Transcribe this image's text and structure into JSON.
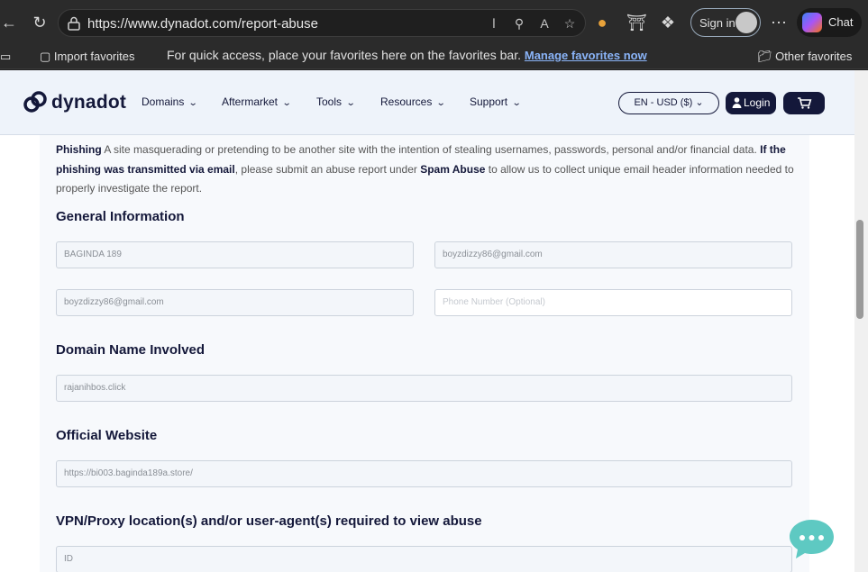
{
  "browser": {
    "url": "https://www.dynadot.com/report-abuse",
    "sign_in_label": "Sign in",
    "chat_label": "Chat"
  },
  "favorites_bar": {
    "import_label": "Import favorites",
    "message": "For quick access, place your favorites here on the favorites bar.",
    "manage_link": "Manage favorites now",
    "other_label": "Other favorites"
  },
  "site": {
    "brand": "dynadot",
    "nav": [
      "Domains",
      "Aftermarket",
      "Tools",
      "Resources",
      "Support"
    ],
    "lang_currency": "EN - USD ($)",
    "login_label": "Login"
  },
  "phishing_note": {
    "term": "Phishing",
    "text1": " A site masquerading or pretending to be another site with the intention of stealing usernames, passwords, personal and/or financial data. ",
    "bold1": "If the phishing was transmitted via email",
    "text2": ", please submit an abuse report under ",
    "bold2": "Spam Abuse",
    "text3": " to allow us to collect unique email header information needed to properly investigate the report."
  },
  "form": {
    "general_heading": "General Information",
    "name_value": "BAGINDA 189",
    "email_value": "boyzdizzy86@gmail.com",
    "confirm_email_value": "boyzdizzy86@gmail.com",
    "phone_placeholder": "Phone Number (Optional)",
    "domain_heading": "Domain Name Involved",
    "domain_value": "rajanihbos.click",
    "website_heading": "Official Website",
    "website_value": "https://bi003.baginda189a.store/",
    "vpn_heading": "VPN/Proxy location(s) and/or user-agent(s) required to view abuse",
    "vpn_value": "ID"
  },
  "colors": {
    "brand_navy": "#14183a",
    "chat_bubble": "#5ec9c2"
  }
}
